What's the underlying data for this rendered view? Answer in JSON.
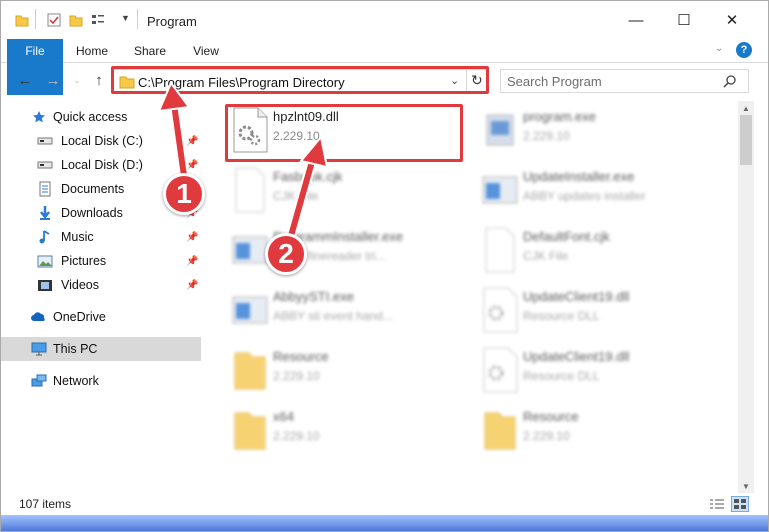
{
  "window": {
    "title": "Program",
    "minimize": "—",
    "maximize": "☐",
    "close": "✕"
  },
  "ribbon": {
    "tabs": [
      "File",
      "Home",
      "Share",
      "View"
    ],
    "help": "?"
  },
  "address": {
    "path": "C:\\Program Files\\Program Directory",
    "refresh": "↻"
  },
  "search": {
    "placeholder": "Search Program",
    "icon": "search-icon"
  },
  "nav": {
    "items": [
      {
        "label": "Quick access",
        "icon": "star-icon"
      },
      {
        "label": "Local Disk (C:)",
        "icon": "drive-icon",
        "pinned": true
      },
      {
        "label": "Local Disk (D:)",
        "icon": "drive-icon",
        "pinned": true
      },
      {
        "label": "Documents",
        "icon": "documents-icon",
        "pinned": true
      },
      {
        "label": "Downloads",
        "icon": "downloads-icon",
        "pinned": true
      },
      {
        "label": "Music",
        "icon": "music-icon",
        "pinned": true
      },
      {
        "label": "Pictures",
        "icon": "pictures-icon",
        "pinned": true
      },
      {
        "label": "Videos",
        "icon": "videos-icon",
        "pinned": true
      },
      {
        "label": "OneDrive",
        "icon": "cloud-icon"
      },
      {
        "label": "This PC",
        "icon": "pc-icon",
        "selected": true
      },
      {
        "label": "Network",
        "icon": "network-icon"
      }
    ]
  },
  "files": [
    {
      "name": "hpzlnt09.dll",
      "sub": "2.229.10",
      "icon": "dll-icon"
    },
    {
      "name": "program.exe",
      "sub": "2.229.10",
      "icon": "exe-icon"
    },
    {
      "name": "Fasbook.cjk",
      "sub": "CJK File",
      "icon": "file-icon"
    },
    {
      "name": "UpdateInstaller.exe",
      "sub": "ABBY updates installer",
      "icon": "window-icon"
    },
    {
      "name": "ProgrammInstaller.exe",
      "sub": "ABBY finereader tri...",
      "icon": "window-icon"
    },
    {
      "name": "DefaultFont.cjk",
      "sub": "CJK File",
      "icon": "file-icon"
    },
    {
      "name": "AbbyySTI.exe",
      "sub": "ABBY sti event hand...",
      "icon": "window-icon"
    },
    {
      "name": "UpdateClient19.dll",
      "sub": "Resource DLL",
      "icon": "dll-icon"
    },
    {
      "name": "Resource",
      "sub": "2.229.10",
      "icon": "folder-icon"
    },
    {
      "name": "UpdateClient19.dll",
      "sub": "Resource DLL",
      "icon": "dll-icon"
    },
    {
      "name": "x64",
      "sub": "2.229.10",
      "icon": "folder-icon"
    },
    {
      "name": "Resource",
      "sub": "2.229.10",
      "icon": "folder-icon"
    }
  ],
  "status": {
    "items": "107 items"
  },
  "callouts": [
    "1",
    "2"
  ],
  "colors": {
    "accent": "#1979ca",
    "highlight": "#e03a3e",
    "selected": "#d9d9d9"
  }
}
